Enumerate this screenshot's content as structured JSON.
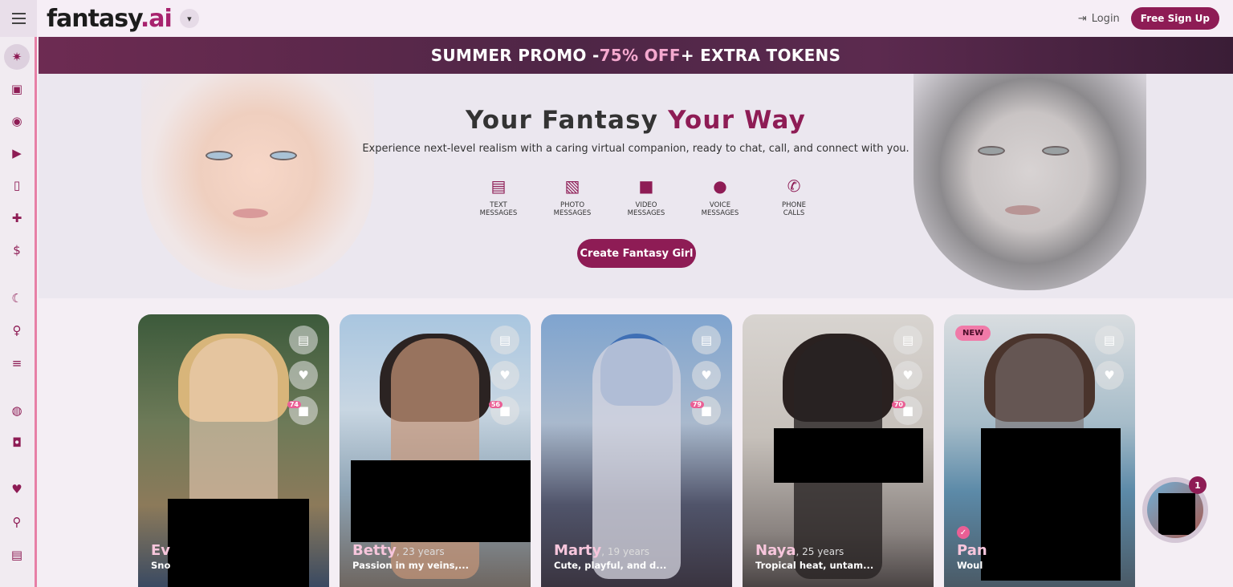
{
  "header": {
    "logo_text": "fantasy",
    "logo_suffix": ".ai",
    "login_label": "Login",
    "signup_label": "Free Sign Up"
  },
  "promo": {
    "part1": "SUMMER PROMO - ",
    "accent": "75% OFF",
    "part2": " + EXTRA TOKENS"
  },
  "hero": {
    "title_part1": "Your Fantasy ",
    "title_accent": "Your Way",
    "subtitle": "Experience next-level realism with a caring virtual companion, ready to chat, call, and connect with you.",
    "features": [
      {
        "line1": "TEXT",
        "line2": "MESSAGES",
        "icon": "text-message-icon"
      },
      {
        "line1": "PHOTO",
        "line2": "MESSAGES",
        "icon": "photo-message-icon"
      },
      {
        "line1": "VIDEO",
        "line2": "MESSAGES",
        "icon": "video-message-icon"
      },
      {
        "line1": "VOICE",
        "line2": "MESSAGES",
        "icon": "microphone-icon"
      },
      {
        "line1": "PHONE",
        "line2": "CALLS",
        "icon": "phone-icon"
      }
    ],
    "cta_label": "Create Fantasy Girl"
  },
  "cards": [
    {
      "name": "Ev",
      "age": "",
      "desc": "Sno",
      "count": "74"
    },
    {
      "name": "Betty",
      "age": ", 23 years",
      "desc": "Passion in my veins,...",
      "count": "56"
    },
    {
      "name": "Marty",
      "age": ", 19 years",
      "desc": "Cute, playful, and d...",
      "count": "79"
    },
    {
      "name": "Naya",
      "age": ", 25 years",
      "desc": "Tropical heat, untam...",
      "count": "70"
    },
    {
      "name": "Pan",
      "age": "",
      "desc": "Woul",
      "badge": "NEW"
    }
  ],
  "float_chat": {
    "badge": "1"
  },
  "colors": {
    "accent": "#8e1c55",
    "pink": "#ea5f95",
    "sidebar_border": "#e77fa6"
  }
}
